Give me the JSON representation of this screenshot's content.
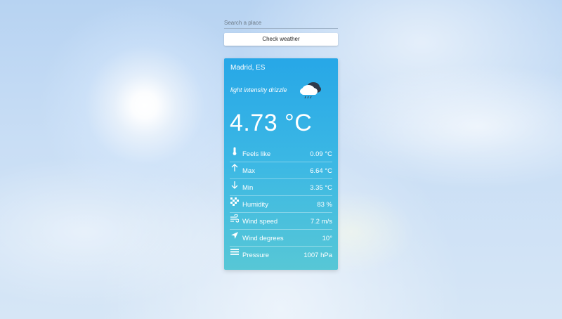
{
  "search": {
    "placeholder": "Search a place",
    "value": ""
  },
  "check_button": {
    "label": "Check weather"
  },
  "weather": {
    "location": "Madrid, ES",
    "description": "light intensity drizzle",
    "icon": "cloud-drizzle-icon",
    "temperature": "4.73 °C",
    "details": [
      {
        "icon": "thermometer-icon",
        "label": "Feels like",
        "value": "0.09 °C"
      },
      {
        "icon": "arrow-up-icon",
        "label": "Max",
        "value": "6.64 °C"
      },
      {
        "icon": "arrow-down-icon",
        "label": "Min",
        "value": "3.35 °C"
      },
      {
        "icon": "humidity-icon",
        "label": "Humidity",
        "value": "83 %"
      },
      {
        "icon": "wind-icon",
        "label": "Wind speed",
        "value": "7.2 m/s"
      },
      {
        "icon": "navigation-arrow-icon",
        "label": "Wind degrees",
        "value": "10°"
      },
      {
        "icon": "pressure-icon",
        "label": "Pressure",
        "value": "1007 hPa"
      }
    ]
  },
  "colors": {
    "card_top": "#27a7e7",
    "card_bottom": "#57c7d6",
    "text": "#ffffff"
  }
}
